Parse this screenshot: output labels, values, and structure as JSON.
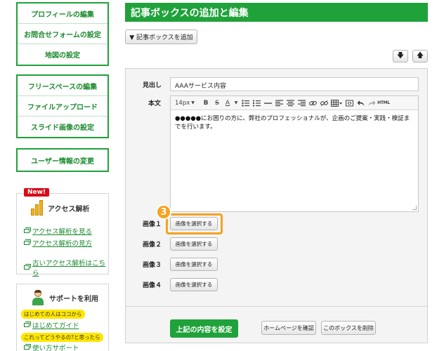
{
  "sidebar": {
    "group1": [
      "プロフィールの編集",
      "お問合せフォームの設定",
      "地図の設定"
    ],
    "group2": [
      "フリースペースの編集",
      "ファイルアップロード",
      "スライド画像の設定"
    ],
    "group3": [
      "ユーザー情報の変更"
    ],
    "analytics": {
      "badge": "New!",
      "title": "アクセス解析",
      "links": [
        "アクセス解析を見る",
        "アクセス解析の見方",
        "古いアクセス解析はこちら"
      ]
    },
    "support": {
      "title": "サポートを利用",
      "tag1": "はじめての人はココから",
      "link1": "はじめてガイド",
      "tag2": "これってどうやるの?と思ったら",
      "link2": "使い方サポート"
    }
  },
  "main": {
    "title": "記事ボックスの追加と編集",
    "add_box_label": "▼ 記事ボックスを追加",
    "down_arrow": "🡇",
    "up_arrow": "🡅",
    "heading_label": "見出し",
    "heading_value": "AAAサービス内容",
    "body_label": "本文",
    "toolbar": {
      "font_size": "14px",
      "bold": "B",
      "strike": "S",
      "text_color": "A",
      "html": "HTML"
    },
    "body_text": "●●●●●にお困りの方に、弊社のプロフェッショナルが、企画のご提案・実践・検証までを行います。",
    "images": [
      {
        "label": "画像１",
        "button": "画像を選択する"
      },
      {
        "label": "画像２",
        "button": "画像を選択する"
      },
      {
        "label": "画像３",
        "button": "画像を選択する"
      },
      {
        "label": "画像４",
        "button": "画像を選択する"
      }
    ],
    "step_number": "3",
    "submit_label": "上記の内容を設定",
    "preview_label": "ホームページを確認",
    "delete_label": "このボックスを削除"
  },
  "colors": {
    "accent_green": "#1fa23a",
    "highlight_orange": "#f5a21e",
    "new_red": "#d80c18"
  }
}
